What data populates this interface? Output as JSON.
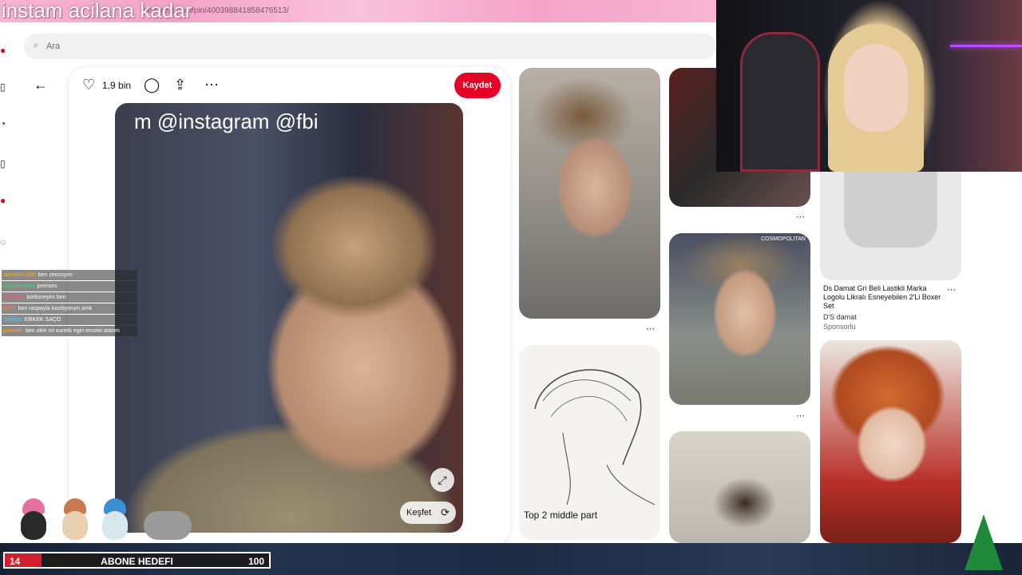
{
  "overlay": {
    "title": "instam acilana kadar",
    "url": "pinterest.com/pin/400398841858476513/"
  },
  "search": {
    "placeholder": "Ara",
    "icon": "search-icon"
  },
  "pin": {
    "like_count": "1,9 bin",
    "save_label": "Kaydet",
    "image_overlay_text": "m @instagram @fbi",
    "explore_label": "Keşfet"
  },
  "chat": {
    "messages": [
      {
        "user": "danisk4124d",
        "text": "ben zencoyim",
        "color": "#f0b030"
      },
      {
        "user": "nisadecesim",
        "text": "prenses",
        "color": "#44dd66"
      },
      {
        "user": "rlorvekili",
        "text": "bix9uneyim ben",
        "color": "#ff5577"
      },
      {
        "user": "lbl3ft",
        "text": "ben raspayla kazitiyorum amk",
        "color": "#ff7744"
      },
      {
        "user": "Saklipo",
        "text": "ERKEK SAÇO",
        "color": "#55ccff"
      },
      {
        "user": "jamsetk",
        "text": "ben olim mi surekli egiri emotei atarım",
        "color": "#ffaa22"
      }
    ]
  },
  "grid": {
    "ad_title": "Ds Damat Gri Beli Lastikli Marka Logolu Likralı Esneyebilen 2'Li Boxer Set",
    "ad_brand": "D'S damat",
    "ad_sponsored": "Sponsorlu",
    "sketch_label": "Top 2 middle part",
    "watermark": "COSMOPOLITAN"
  },
  "goal": {
    "label": "ABONE HEDEFI",
    "current": "14",
    "target": "100",
    "progress_fraction": 0.14
  },
  "colors": {
    "save": "#e60023",
    "goal_fill": "#d01f2e"
  }
}
